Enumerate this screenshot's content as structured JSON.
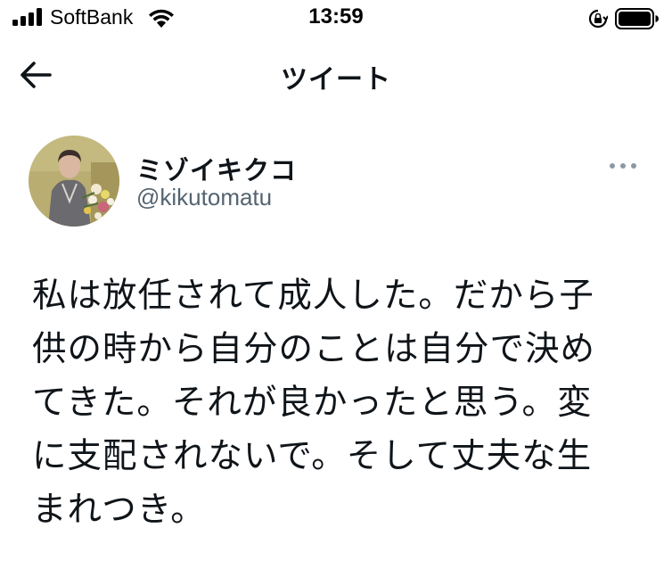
{
  "status_bar": {
    "carrier": "SoftBank",
    "time": "13:59",
    "icons": [
      "signal-icon",
      "wifi-icon",
      "orientation-lock-icon",
      "battery-icon"
    ]
  },
  "nav": {
    "title": "ツイート",
    "back_icon": "back-arrow-icon"
  },
  "author": {
    "display_name": "ミゾイキクコ",
    "handle": "@kikutomatu",
    "avatar_icon": "avatar"
  },
  "more_icon": "more-options-icon",
  "tweet": {
    "lines": [
      "私は放任されて成人した。だから子",
      "供の時から自分のことは自分で決め",
      "てきた。それが良かったと思う。変",
      "に支配されないで。そして丈夫な生",
      "まれつき。"
    ]
  },
  "colors": {
    "text": "#0f1419",
    "secondary": "#536471",
    "background": "#ffffff"
  }
}
